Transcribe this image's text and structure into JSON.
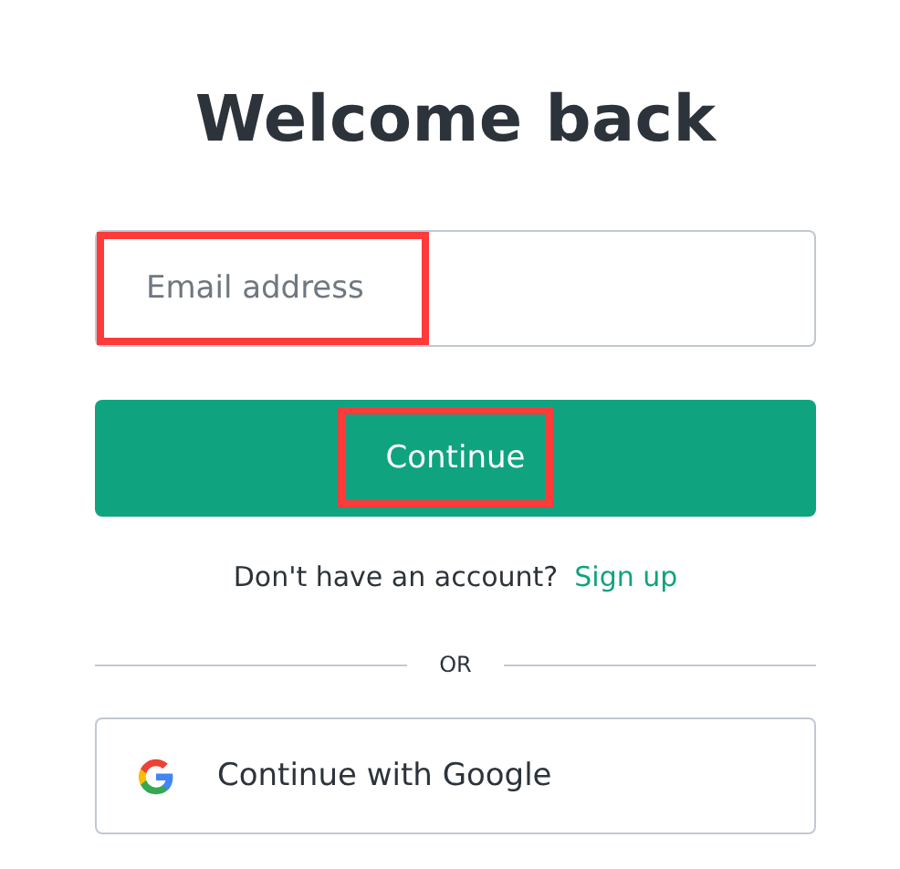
{
  "title": "Welcome back",
  "email_field": {
    "placeholder": "Email address",
    "highlighted": true
  },
  "continue_button": {
    "label": "Continue",
    "highlighted": true
  },
  "signup_prompt": {
    "text": "Don't have an account?",
    "link": "Sign up"
  },
  "divider": {
    "label": "OR"
  },
  "social_buttons": [
    {
      "kind": "google",
      "label": "Continue with Google"
    }
  ]
}
